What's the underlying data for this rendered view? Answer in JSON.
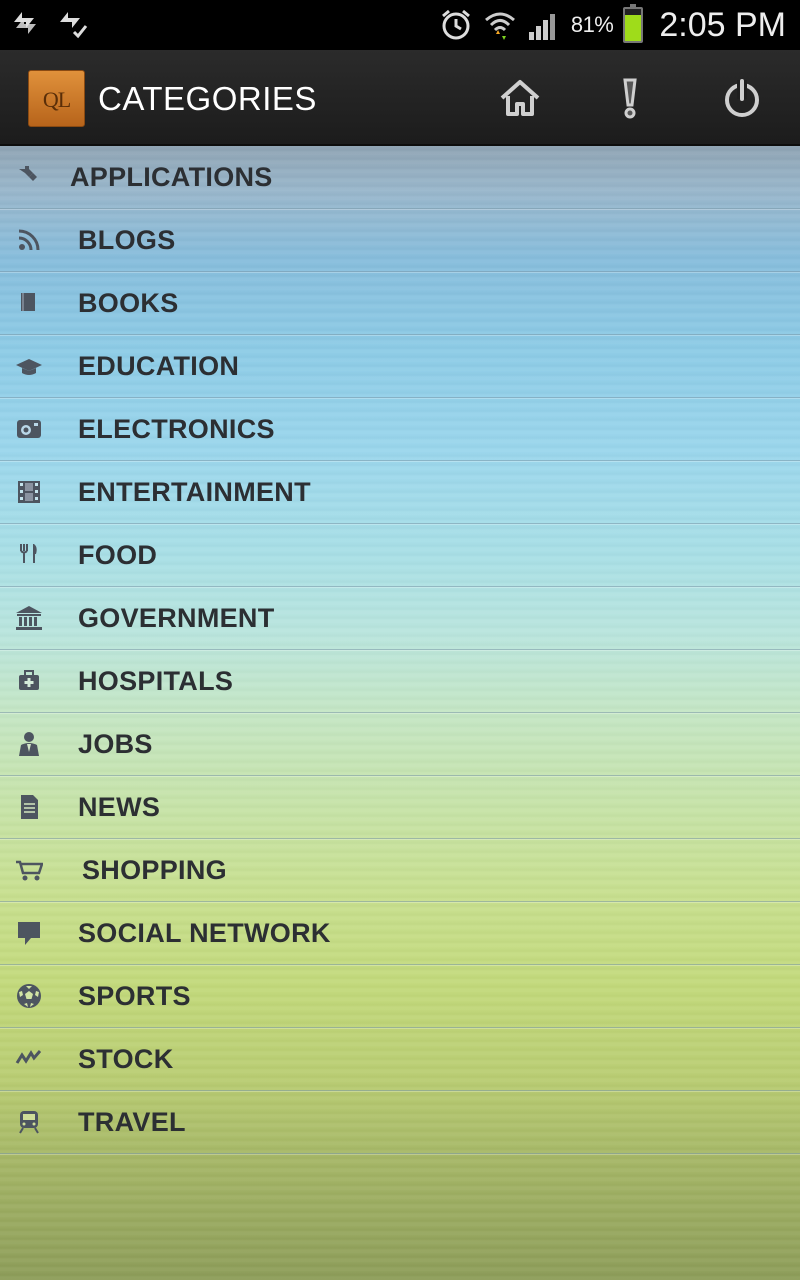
{
  "status_bar": {
    "battery_percent": "81%",
    "time": "2:05 PM",
    "battery_level": 0.81,
    "battery_color": "#9fdc1a"
  },
  "action_bar": {
    "logo_text": "QL",
    "title": "CATEGORIES",
    "buttons": [
      {
        "name": "home-icon"
      },
      {
        "name": "alert-icon"
      },
      {
        "name": "power-icon"
      }
    ]
  },
  "categories": [
    {
      "label": "APPLICATIONS",
      "icon": "puzzle-icon"
    },
    {
      "label": "BLOGS",
      "icon": "rss-icon"
    },
    {
      "label": "BOOKS",
      "icon": "book-icon"
    },
    {
      "label": "EDUCATION",
      "icon": "graduation-cap-icon"
    },
    {
      "label": "ELECTRONICS",
      "icon": "camera-icon"
    },
    {
      "label": "ENTERTAINMENT",
      "icon": "film-icon"
    },
    {
      "label": "FOOD",
      "icon": "fork-knife-icon"
    },
    {
      "label": "GOVERNMENT",
      "icon": "building-icon"
    },
    {
      "label": "HOSPITALS",
      "icon": "medical-kit-icon"
    },
    {
      "label": "JOBS",
      "icon": "businessman-icon"
    },
    {
      "label": "NEWS",
      "icon": "document-icon"
    },
    {
      "label": "SHOPPING",
      "icon": "cart-icon"
    },
    {
      "label": "SOCIAL NETWORK",
      "icon": "speech-bubble-icon"
    },
    {
      "label": "SPORTS",
      "icon": "soccer-ball-icon"
    },
    {
      "label": "STOCK",
      "icon": "stock-chart-icon"
    },
    {
      "label": "TRAVEL",
      "icon": "train-icon"
    }
  ]
}
